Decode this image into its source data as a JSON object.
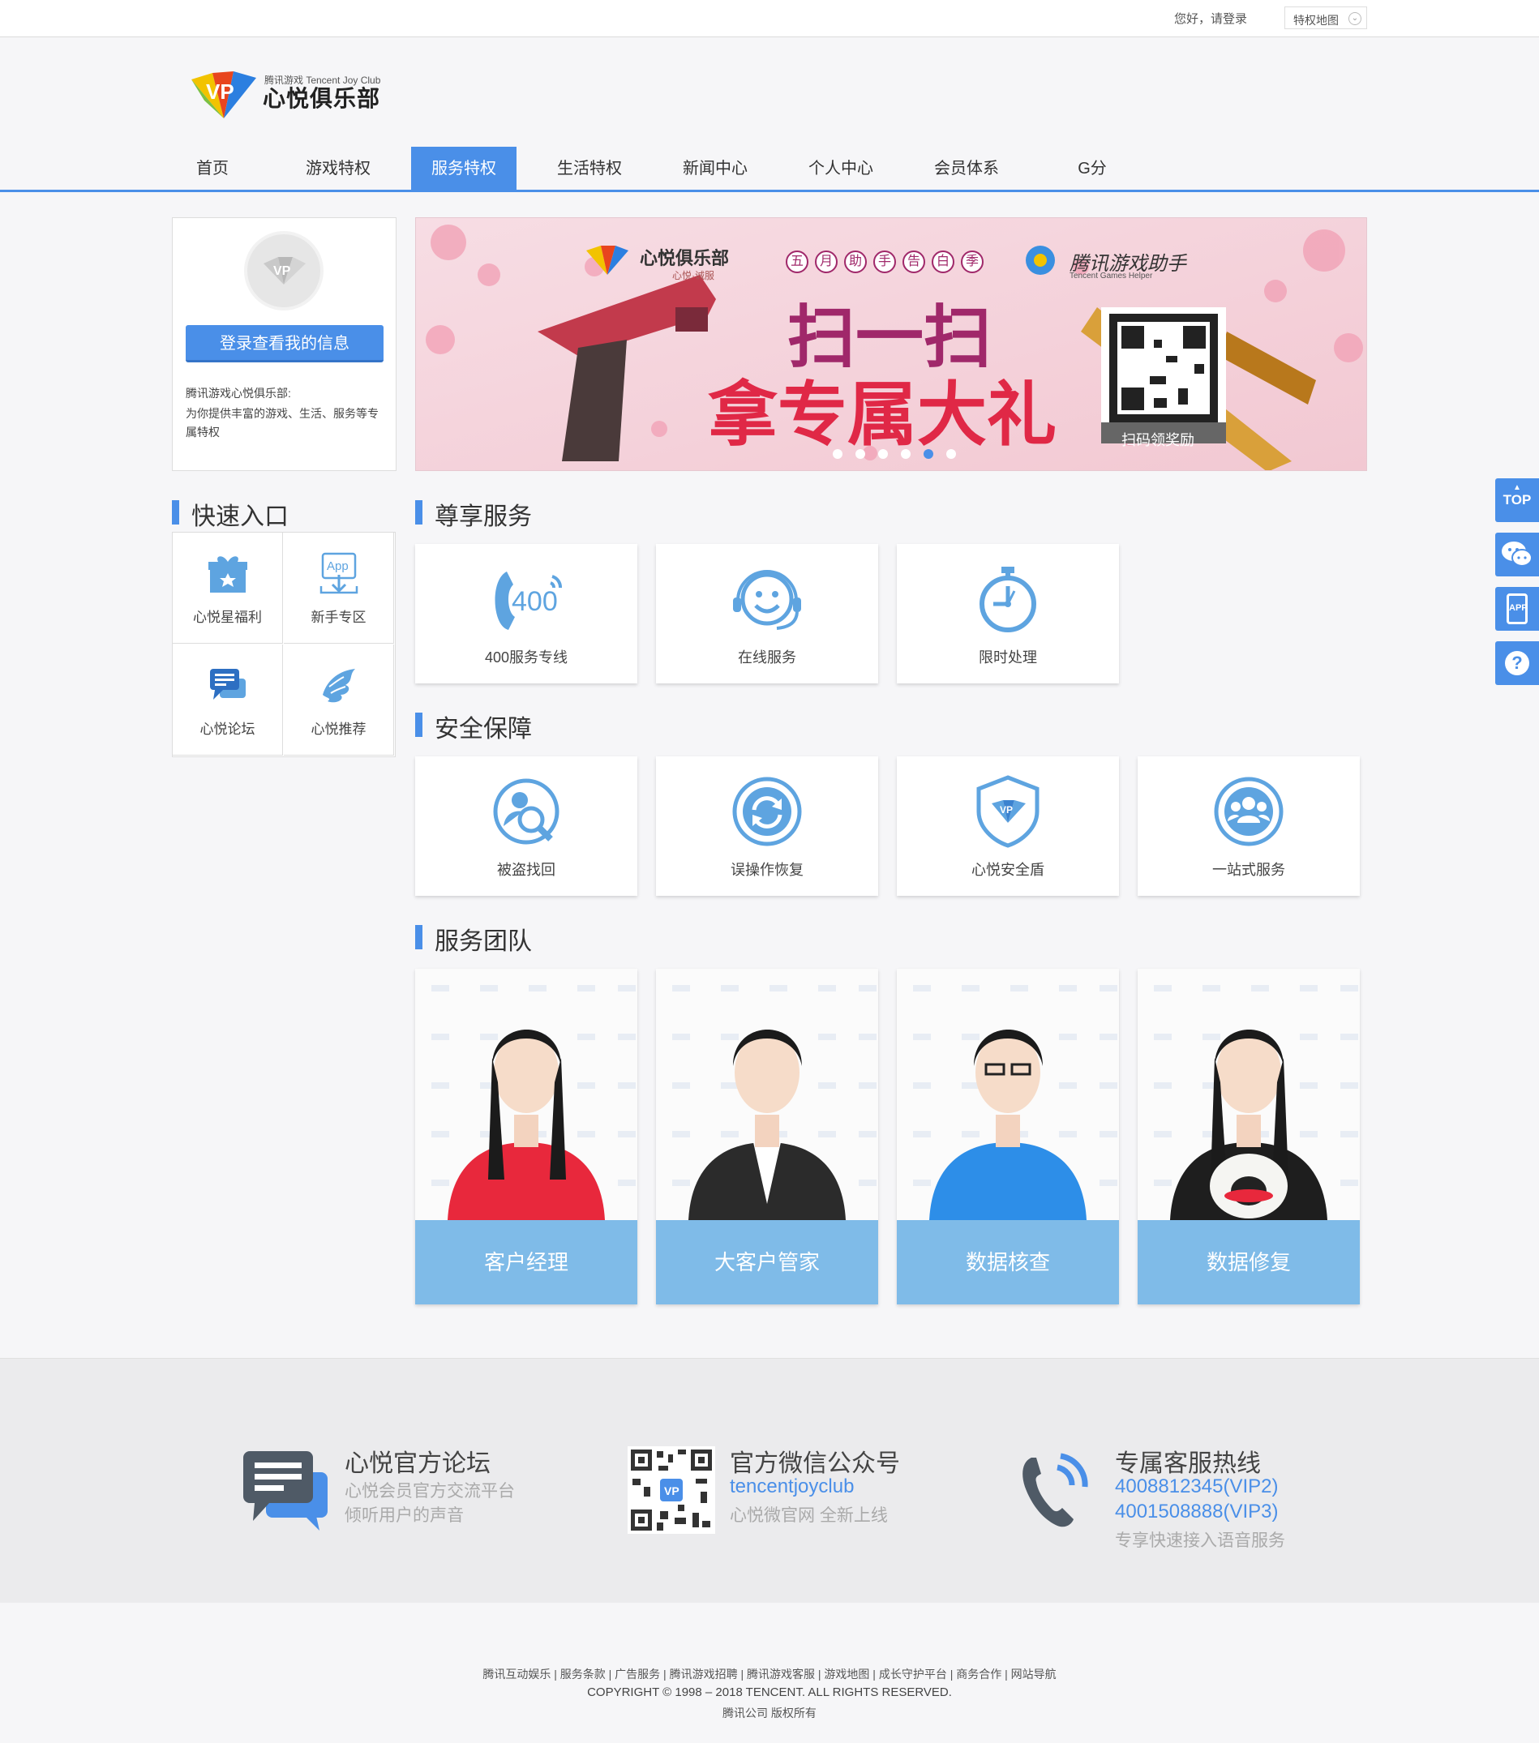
{
  "topbar": {
    "greeting": "您好，请登录",
    "sitemap": "特权地图"
  },
  "logo": {
    "en": "腾讯游戏 Tencent Joy Club",
    "cn": "心悦俱乐部"
  },
  "nav": [
    "首页",
    "游戏特权",
    "服务特权",
    "生活特权",
    "新闻中心",
    "个人中心",
    "会员体系",
    "G分"
  ],
  "nav_active": "服务特权",
  "profile": {
    "login_button": "登录查看我的信息",
    "desc_line1": "腾讯游戏心悦俱乐部:",
    "desc_line2": "为你提供丰富的游戏、生活、服务等专属特权"
  },
  "banner": {
    "brand": "心悦俱乐部",
    "brand_sub": "心悦·诚服",
    "campaign_chars": [
      "五",
      "月",
      "助",
      "手",
      "告",
      "白",
      "季"
    ],
    "partner": "腾讯游戏助手",
    "partner_en": "Tencent Games Helper",
    "headline1": "扫一扫",
    "headline2": "拿专属大礼",
    "qr_caption": "扫码领奖励",
    "dots_count": 6,
    "active_dot": 5
  },
  "quick": {
    "heading": "快速入口",
    "items": [
      {
        "label": "心悦星福利",
        "icon": "gift-icon"
      },
      {
        "label": "新手专区",
        "icon": "app-download-icon"
      },
      {
        "label": "心悦论坛",
        "icon": "chat-icon"
      },
      {
        "label": "心悦推荐",
        "icon": "dragon-icon"
      }
    ]
  },
  "premium": {
    "heading": "尊享服务",
    "items": [
      {
        "label": "400服务专线",
        "icon": "phone-400-icon"
      },
      {
        "label": "在线服务",
        "icon": "smiley-headset-icon"
      },
      {
        "label": "限时处理",
        "icon": "stopwatch-icon"
      }
    ]
  },
  "security": {
    "heading": "安全保障",
    "items": [
      {
        "label": "被盗找回",
        "icon": "user-search-icon"
      },
      {
        "label": "误操作恢复",
        "icon": "refresh-icon"
      },
      {
        "label": "心悦安全盾",
        "icon": "shield-icon"
      },
      {
        "label": "一站式服务",
        "icon": "group-icon"
      }
    ]
  },
  "team": {
    "heading": "服务团队",
    "members": [
      "客户经理",
      "大客户管家",
      "数据核查",
      "数据修复"
    ]
  },
  "footer": {
    "forum": {
      "title": "心悦官方论坛",
      "line1": "心悦会员官方交流平台",
      "line2": "倾听用户的声音"
    },
    "wechat": {
      "title": "官方微信公众号",
      "account": "tencentjoyclub",
      "line": "心悦微官网 全新上线"
    },
    "hotline": {
      "title": "专属客服热线",
      "vip2": "4008812345(VIP2)",
      "vip3": "4001508888(VIP3)",
      "line": "专享快速接入语音服务"
    },
    "links": "腾讯互动娱乐 | 服务条款 | 广告服务 | 腾讯游戏招聘 | 腾讯游戏客服 | 游戏地图 | 成长守护平台 | 商务合作 | 网站导航",
    "copyright": "COPYRIGHT © 1998 – 2018 TENCENT. ALL RIGHTS RESERVED.",
    "rights": "腾讯公司 版权所有"
  },
  "side": {
    "top_label": "TOP",
    "app_label": "APP",
    "help_label": "?"
  },
  "colors": {
    "accent": "#4a8fe8",
    "team_label_bg": "#7fbbe8",
    "icon_blue": "#5ea4e0"
  }
}
